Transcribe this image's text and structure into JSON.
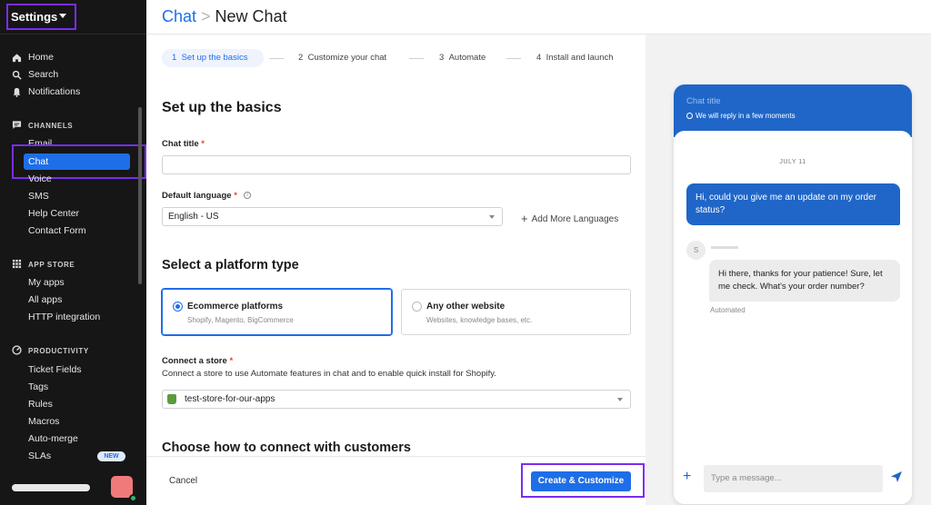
{
  "sidebar": {
    "title": "Settings",
    "nav": [
      "Home",
      "Search",
      "Notifications"
    ],
    "sections": [
      {
        "label": "CHANNELS",
        "items": [
          "Email",
          "Chat",
          "Voice",
          "SMS",
          "Help Center",
          "Contact Form"
        ]
      },
      {
        "label": "APP STORE",
        "items": [
          "My apps",
          "All apps",
          "HTTP integration"
        ]
      },
      {
        "label": "PRODUCTIVITY",
        "items": [
          "Ticket Fields",
          "Tags",
          "Rules",
          "Macros",
          "Auto-merge",
          "SLAs"
        ]
      }
    ],
    "badge_new": "NEW",
    "active_item": "Chat"
  },
  "header": {
    "breadcrumb_parent": "Chat",
    "separator": ">",
    "breadcrumb_current": "New Chat"
  },
  "stepper": [
    {
      "num": "1",
      "label": "Set up the basics",
      "active": true
    },
    {
      "num": "2",
      "label": "Customize your chat"
    },
    {
      "num": "3",
      "label": "Automate"
    },
    {
      "num": "4",
      "label": "Install and launch"
    }
  ],
  "form": {
    "heading": "Set up the basics",
    "chat_title_label": "Chat title",
    "chat_title_value": "",
    "language_label": "Default language",
    "language_value": "English - US",
    "add_languages": "Add More Languages",
    "platform_heading": "Select a platform type",
    "platform_options": [
      {
        "title": "Ecommerce platforms",
        "sub": "Shopify, Magento, BigCommerce",
        "selected": true
      },
      {
        "title": "Any other website",
        "sub": "Websites, knowledge bases, etc.",
        "selected": false
      }
    ],
    "store_label": "Connect a store",
    "store_desc": "Connect a store to use Automate features in chat and to enable quick install for Shopify.",
    "store_value": "test-store-for-our-apps",
    "connect_heading": "Choose how to connect with customers",
    "required_mark": "*"
  },
  "footer": {
    "cancel": "Cancel",
    "create": "Create & Customize"
  },
  "preview": {
    "title": "Chat title",
    "subtitle": "We will reply in a few moments",
    "date": "JULY 11",
    "customer_message": "Hi, could you give me an update on my order status?",
    "agent_initial": "S",
    "agent_message": "Hi there, thanks for your patience! Sure, let me check. What's your order number?",
    "automated_label": "Automated",
    "composer_placeholder": "Type a message...",
    "accent_color": "#1f66c8"
  },
  "colors": {
    "brand_blue": "#1e6ee8",
    "highlight_purple": "#7a2df0",
    "sidebar_bg": "#161616"
  }
}
